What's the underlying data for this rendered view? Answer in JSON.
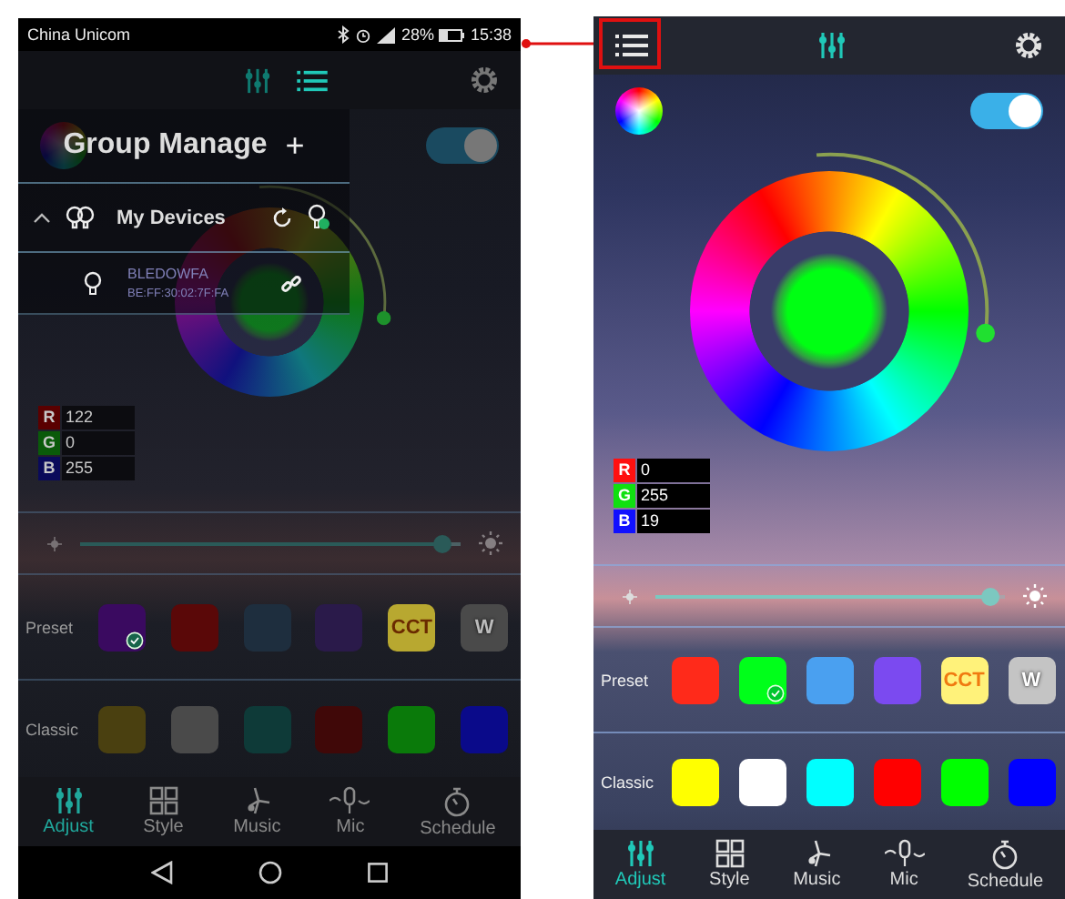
{
  "phones": [
    {
      "status_bar": {
        "carrier": "China Unicom",
        "battery": "28%",
        "time": "15:38"
      },
      "drawer": {
        "title": "Group Manage",
        "add": "+",
        "groups": [
          {
            "name": "My Devices",
            "expanded": true,
            "devices": [
              {
                "name": "BLEDOWFA",
                "address": "BE:FF:30:02:7F:FA"
              }
            ]
          }
        ]
      },
      "power": {
        "on": true
      },
      "rgb": [
        {
          "channel": "R",
          "value": "122",
          "color": "#5a0000"
        },
        {
          "channel": "G",
          "value": "0",
          "color": "#0a5a0a"
        },
        {
          "channel": "B",
          "value": "255",
          "color": "#0a0a5a"
        }
      ],
      "brightness": {
        "level": 0.95
      },
      "preset": {
        "label": "Preset",
        "swatches": [
          {
            "kind": "plain",
            "color": "#3a0a60",
            "selected": true
          },
          {
            "kind": "plain",
            "color": "#5a0808",
            "selected": false
          },
          {
            "kind": "plain",
            "color": "#1e2e3e",
            "selected": false
          },
          {
            "kind": "plain",
            "color": "#2a1a4a",
            "selected": false
          },
          {
            "kind": "cct",
            "text": "CCT",
            "color": "#b8a830",
            "selected": false
          },
          {
            "kind": "white",
            "text": "W",
            "color": "#4a4a4a",
            "selected": false
          }
        ]
      },
      "classic": {
        "label": "Classic",
        "swatches": [
          {
            "color": "#4a4010"
          },
          {
            "color": "#4a4a4a"
          },
          {
            "color": "#0e3a38"
          },
          {
            "color": "#400808"
          },
          {
            "color": "#0a7a0a"
          },
          {
            "color": "#0a0a8a"
          }
        ]
      },
      "tabs": [
        {
          "kind": "adjust",
          "label": "Adjust",
          "selected": true
        },
        {
          "kind": "style",
          "label": "Style",
          "selected": false
        },
        {
          "kind": "music",
          "label": "Music",
          "selected": false
        },
        {
          "kind": "mic",
          "label": "Mic",
          "selected": false
        },
        {
          "kind": "schedule",
          "label": "Schedule",
          "selected": false
        }
      ],
      "navigation_bar": true
    },
    {
      "menu_highlighted": true,
      "power": {
        "on": true
      },
      "rgb": [
        {
          "channel": "R",
          "value": "0",
          "color": "#ff1010"
        },
        {
          "channel": "G",
          "value": "255",
          "color": "#10e010"
        },
        {
          "channel": "B",
          "value": "19",
          "color": "#1010ff"
        }
      ],
      "brightness": {
        "level": 0.96
      },
      "preset": {
        "label": "Preset",
        "swatches": [
          {
            "kind": "plain",
            "color": "#ff2a1a",
            "selected": false
          },
          {
            "kind": "plain",
            "color": "#00ff1a",
            "selected": true
          },
          {
            "kind": "plain",
            "color": "#4aa0f0",
            "selected": false
          },
          {
            "kind": "plain",
            "color": "#7b4af0",
            "selected": false
          },
          {
            "kind": "cct",
            "text": "CCT",
            "color": "#fff27a",
            "selected": false
          },
          {
            "kind": "white",
            "text": "W",
            "color": "#c4c4c4",
            "selected": false
          }
        ]
      },
      "classic": {
        "label": "Classic",
        "swatches": [
          {
            "color": "#ffff00"
          },
          {
            "color": "#ffffff"
          },
          {
            "color": "#00ffff"
          },
          {
            "color": "#ff0000"
          },
          {
            "color": "#00ff00"
          },
          {
            "color": "#0000ff"
          }
        ]
      },
      "tabs": [
        {
          "kind": "adjust",
          "label": "Adjust",
          "selected": true
        },
        {
          "kind": "style",
          "label": "Style",
          "selected": false
        },
        {
          "kind": "music",
          "label": "Music",
          "selected": false
        },
        {
          "kind": "mic",
          "label": "Mic",
          "selected": false
        },
        {
          "kind": "schedule",
          "label": "Schedule",
          "selected": false
        }
      ]
    }
  ]
}
